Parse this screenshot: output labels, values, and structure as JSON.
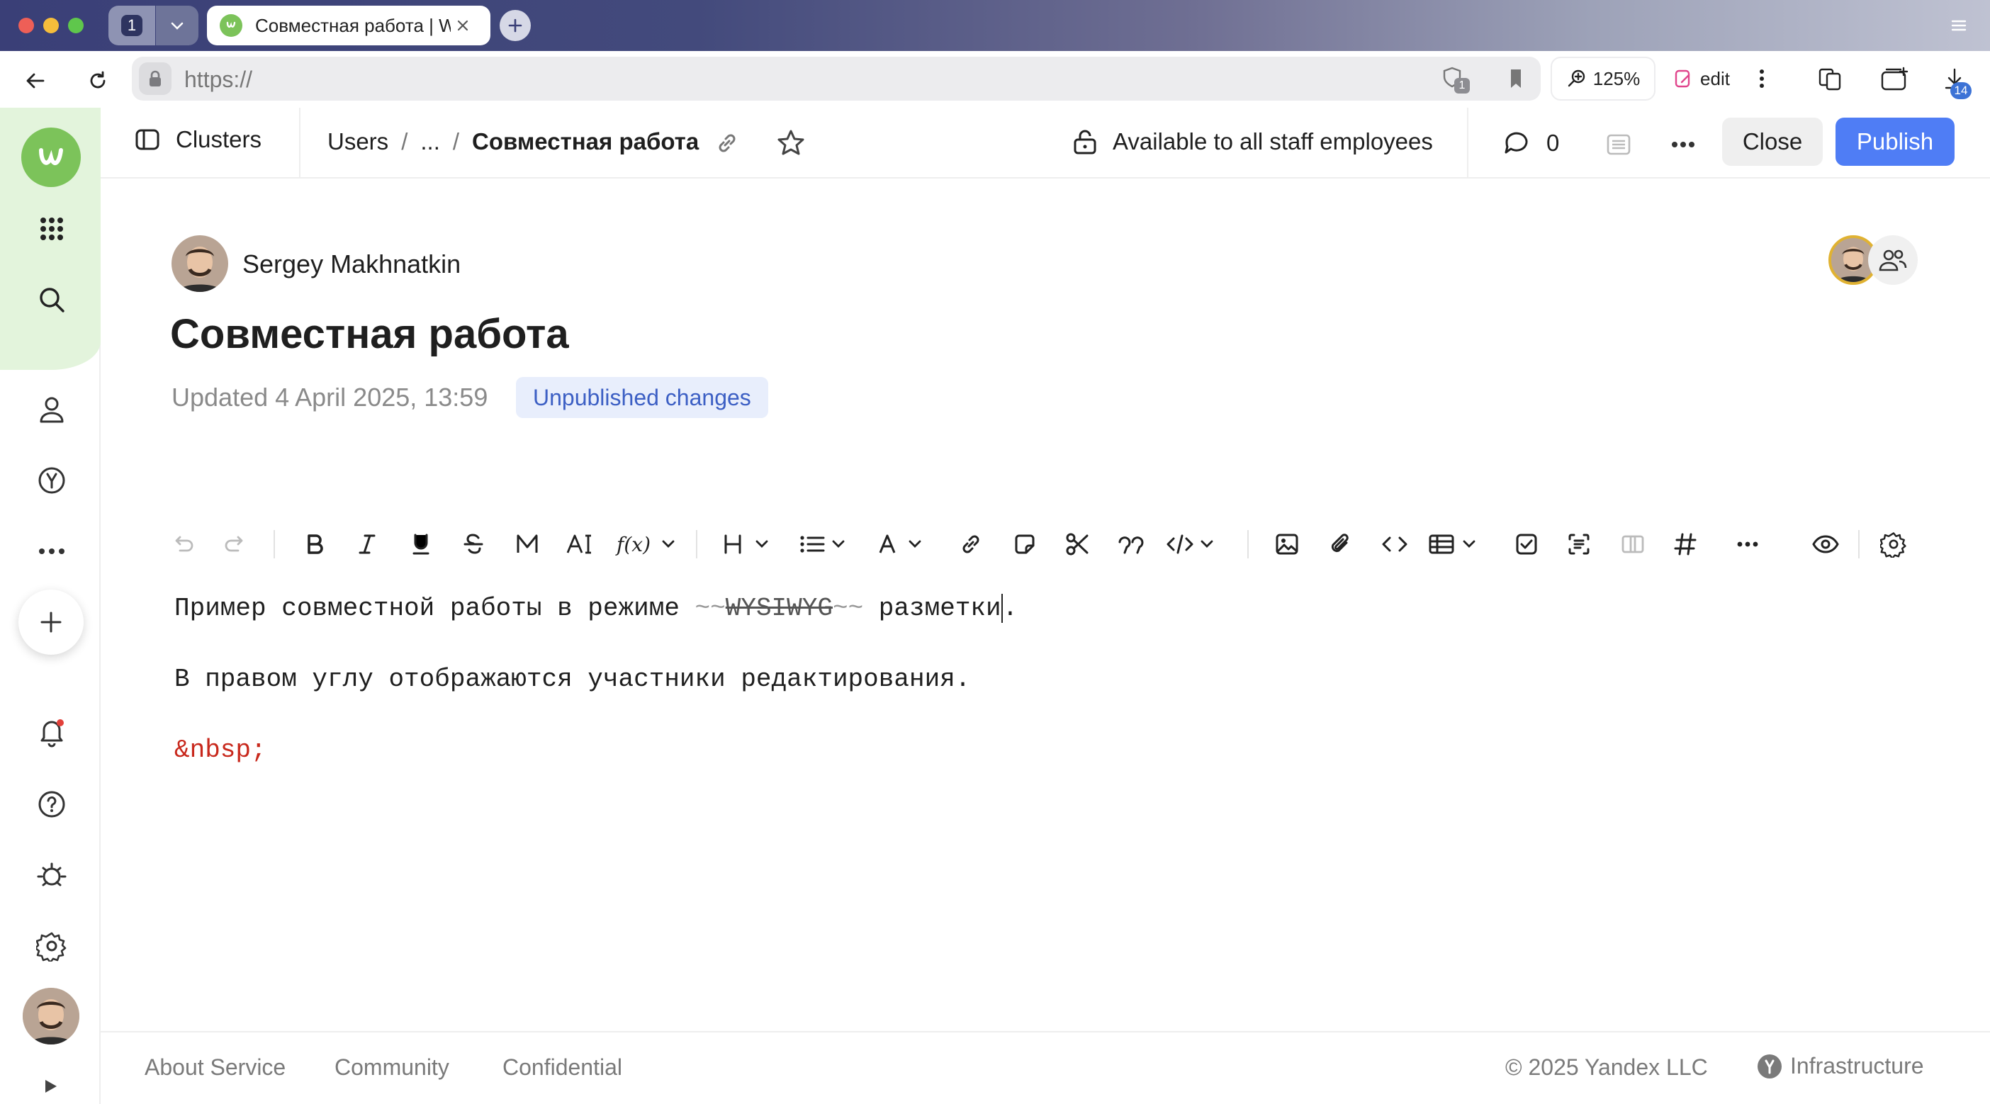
{
  "browser": {
    "tab_count": "1",
    "tab_title": "Совместная работа | W",
    "url": "https://",
    "shield_count": "1",
    "zoom": "125%",
    "edit_label": "edit",
    "downloads_badge": "14"
  },
  "header": {
    "clusters_label": "Clusters",
    "breadcrumb_root": "Users",
    "breadcrumb_sep": "/",
    "breadcrumb_ellipsis": "...",
    "breadcrumb_current": "Совместная работа",
    "access_label": "Available to all staff employees",
    "comment_count": "0",
    "close_label": "Close",
    "publish_label": "Publish"
  },
  "page": {
    "author": "Sergey Makhnatkin",
    "title": "Совместная работа",
    "updated": "Updated 4 April 2025, 13:59",
    "badge": "Unpublished changes"
  },
  "editor": {
    "line1_before": "Пример совместной работы в режиме ",
    "line1_marker": "~~",
    "line1_strike": "WYSIWYG",
    "line1_after": " разметки",
    "line1_end": ".",
    "line2": "В правом углу отображаются участники редактирования.",
    "line3": "&nbsp;"
  },
  "footer": {
    "about": "About Service",
    "community": "Community",
    "confidential": "Confidential",
    "copyright": "© 2025 Yandex LLC",
    "infrastructure": "Infrastructure"
  },
  "colors": {
    "accent": "#4f7df5",
    "badge_bg": "#e8eefc",
    "badge_text": "#3c5fc4",
    "nbsp_red": "#c8281c",
    "rail_green": "#e3f4dc",
    "logo_green": "#7cc35a"
  }
}
